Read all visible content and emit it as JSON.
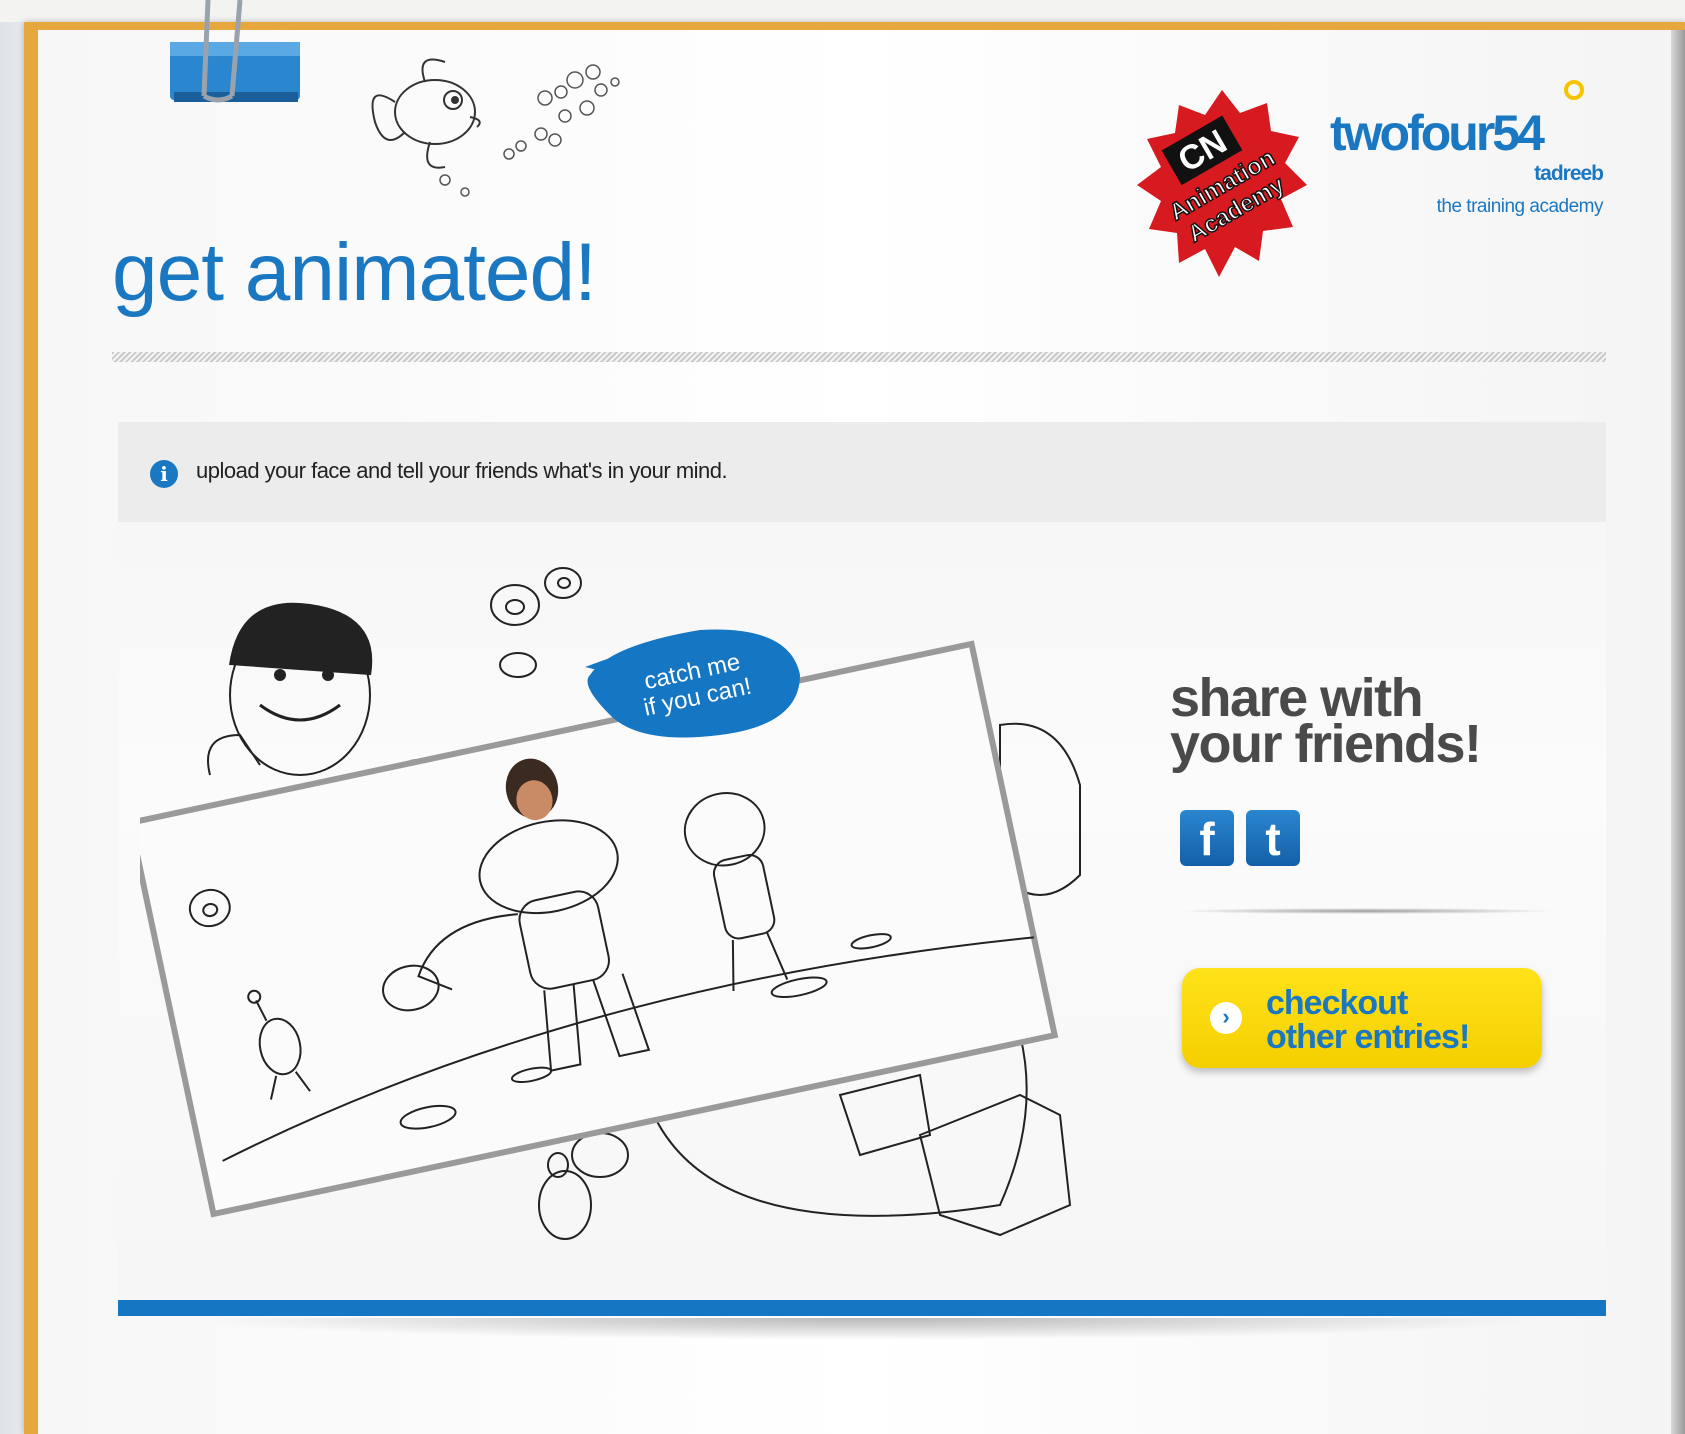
{
  "header": {
    "title": "get animated!"
  },
  "logos": {
    "cn_academy": {
      "line1": "CN",
      "line2": "Animation",
      "line3": "Academy"
    },
    "twofour54": {
      "name": "twofour54",
      "sub": "tadreeb",
      "tagline": "the training academy"
    }
  },
  "info": {
    "icon": "info-icon",
    "text": "upload your face and tell your friends what's in your mind."
  },
  "scene": {
    "speech_line1": "catch me",
    "speech_line2": "if you can!"
  },
  "share": {
    "line1": "share with",
    "line2": "your friends!",
    "facebook_glyph": "f",
    "twitter_glyph": "t"
  },
  "checkout": {
    "line1": "checkout",
    "line2": "other entries!"
  },
  "colors": {
    "brand_blue": "#1a78c2",
    "accent_yellow": "#ffe21a",
    "frame_orange": "#e6a73c",
    "cn_red": "#d71920"
  }
}
